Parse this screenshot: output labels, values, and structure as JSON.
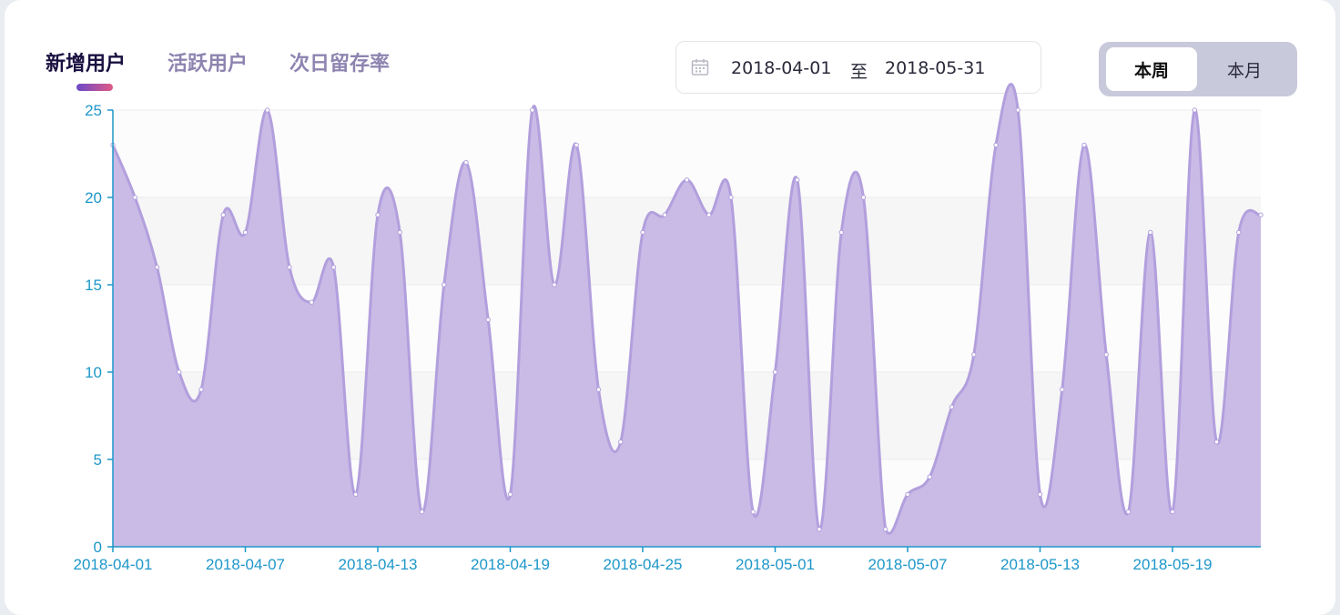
{
  "tabs": [
    {
      "label": "新增用户",
      "active": true
    },
    {
      "label": "活跃用户",
      "active": false
    },
    {
      "label": "次日留存率",
      "active": false
    }
  ],
  "date_range": {
    "start": "2018-04-01",
    "separator": "至",
    "end": "2018-05-31",
    "icon": "calendar-icon"
  },
  "period_toggle": {
    "week_label": "本周",
    "month_label": "本月",
    "selected": "本周"
  },
  "colors": {
    "area_fill": "#c9bbe6",
    "line": "#b29fdd",
    "axis": "#1d97c9",
    "tab_underline": [
      "#6a49c8",
      "#e15a86"
    ]
  },
  "chart_data": {
    "type": "area",
    "smooth": true,
    "x": [
      "2018-04-01",
      "2018-04-02",
      "2018-04-03",
      "2018-04-04",
      "2018-04-05",
      "2018-04-06",
      "2018-04-07",
      "2018-04-08",
      "2018-04-09",
      "2018-04-10",
      "2018-04-11",
      "2018-04-12",
      "2018-04-13",
      "2018-04-14",
      "2018-04-15",
      "2018-04-16",
      "2018-04-17",
      "2018-04-18",
      "2018-04-19",
      "2018-04-20",
      "2018-04-21",
      "2018-04-22",
      "2018-04-23",
      "2018-04-24",
      "2018-04-25",
      "2018-04-26",
      "2018-04-27",
      "2018-04-28",
      "2018-04-29",
      "2018-04-30",
      "2018-05-01",
      "2018-05-02",
      "2018-05-03",
      "2018-05-04",
      "2018-05-05",
      "2018-05-06",
      "2018-05-07",
      "2018-05-08",
      "2018-05-09",
      "2018-05-10",
      "2018-05-11",
      "2018-05-12",
      "2018-05-13",
      "2018-05-14",
      "2018-05-15",
      "2018-05-16",
      "2018-05-17",
      "2018-05-18",
      "2018-05-19",
      "2018-05-20",
      "2018-05-21",
      "2018-05-22",
      "2018-05-23"
    ],
    "values": [
      23,
      20,
      16,
      10,
      9,
      19,
      18,
      25,
      16,
      14,
      16,
      3,
      19,
      18,
      2,
      15,
      22,
      13,
      3,
      25,
      15,
      23,
      9,
      6,
      18,
      19,
      21,
      19,
      20,
      2,
      10,
      21,
      1,
      18,
      20,
      1,
      3,
      4,
      8,
      11,
      23,
      25,
      3,
      9,
      23,
      11,
      2,
      18,
      2,
      25,
      6,
      18,
      19
    ],
    "xticks": [
      "2018-04-01",
      "2018-04-07",
      "2018-04-13",
      "2018-04-19",
      "2018-04-25",
      "2018-05-01",
      "2018-05-07",
      "2018-05-13",
      "2018-05-19"
    ],
    "yticks": [
      0,
      5,
      10,
      15,
      20,
      25
    ],
    "ylim": [
      0,
      25
    ],
    "grid": "horizontal bands",
    "xlabel": "",
    "ylabel": ""
  }
}
